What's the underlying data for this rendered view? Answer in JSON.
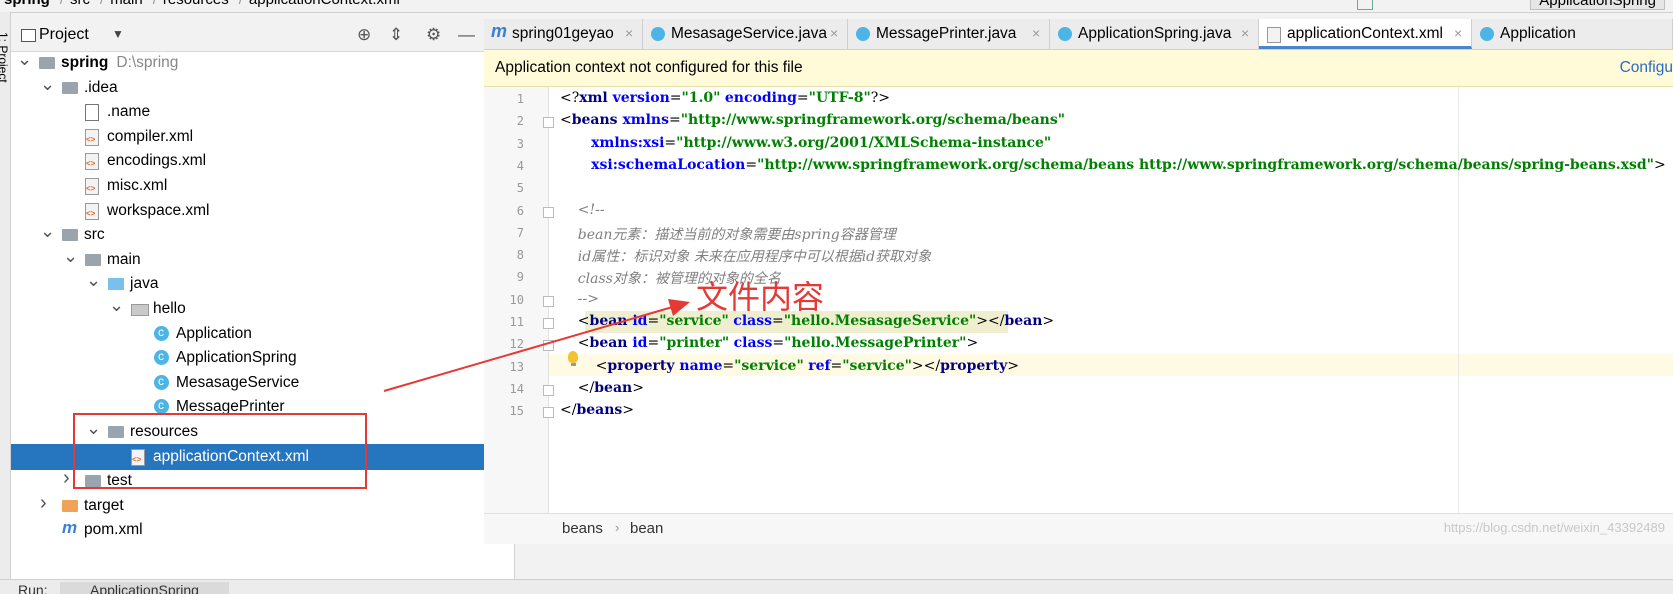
{
  "breadcrumb": [
    "spring",
    "src",
    "main",
    "resources",
    "applicationContext.xml"
  ],
  "run_config": "ApplicationSpring",
  "side_stripe_label": "1: Project",
  "project_panel": {
    "title": "Project",
    "tree": [
      {
        "label": "spring",
        "sub": "D:\\spring",
        "depth": 0,
        "expanded": true,
        "icon": "folder-icon",
        "bold": true
      },
      {
        "label": ".idea",
        "depth": 1,
        "expanded": true,
        "icon": "folder-icon"
      },
      {
        "label": ".name",
        "depth": 2,
        "icon": "file-icon"
      },
      {
        "label": "compiler.xml",
        "depth": 2,
        "icon": "xml-icon"
      },
      {
        "label": "encodings.xml",
        "depth": 2,
        "icon": "xml-icon"
      },
      {
        "label": "misc.xml",
        "depth": 2,
        "icon": "xml-icon"
      },
      {
        "label": "workspace.xml",
        "depth": 2,
        "icon": "xml-icon"
      },
      {
        "label": "src",
        "depth": 1,
        "expanded": true,
        "icon": "folder-icon"
      },
      {
        "label": "main",
        "depth": 2,
        "expanded": true,
        "icon": "folder-icon"
      },
      {
        "label": "java",
        "depth": 3,
        "expanded": true,
        "icon": "source-folder-icon"
      },
      {
        "label": "hello",
        "depth": 4,
        "expanded": true,
        "icon": "package-icon"
      },
      {
        "label": "Application",
        "depth": 5,
        "icon": "class-icon"
      },
      {
        "label": "ApplicationSpring",
        "depth": 5,
        "icon": "class-icon"
      },
      {
        "label": "MesasageService",
        "depth": 5,
        "icon": "class-icon"
      },
      {
        "label": "MessagePrinter",
        "depth": 5,
        "icon": "class-icon"
      },
      {
        "label": "resources",
        "depth": 3,
        "expanded": true,
        "icon": "resources-folder-icon"
      },
      {
        "label": "applicationContext.xml",
        "depth": 4,
        "icon": "xml-icon",
        "selected": true
      },
      {
        "label": "test",
        "depth": 2,
        "expanded": false,
        "icon": "folder-icon"
      },
      {
        "label": "target",
        "depth": 1,
        "expanded": false,
        "icon": "excluded-folder-icon"
      },
      {
        "label": "pom.xml",
        "depth": 1,
        "icon": "maven-icon"
      }
    ]
  },
  "tabs": [
    {
      "label": "spring01geyao",
      "icon": "maven-icon"
    },
    {
      "label": "MesasageService.java",
      "icon": "class-icon"
    },
    {
      "label": "MessagePrinter.java",
      "icon": "class-icon"
    },
    {
      "label": "ApplicationSpring.java",
      "icon": "class-icon"
    },
    {
      "label": "applicationContext.xml",
      "icon": "xml-icon",
      "active": true
    },
    {
      "label": "Application",
      "icon": "class-icon"
    }
  ],
  "banner": {
    "message": "Application context not configured for this file",
    "action": "Configu"
  },
  "code_lines": [
    [
      [
        "plain",
        "<?"
      ],
      [
        "tag",
        "xml "
      ],
      [
        "attr",
        "version"
      ],
      [
        "plain",
        "="
      ],
      [
        "val",
        "\"1.0\""
      ],
      [
        "plain",
        " "
      ],
      [
        "attr",
        "encoding"
      ],
      [
        "plain",
        "="
      ],
      [
        "val",
        "\"UTF-8\""
      ],
      [
        "plain",
        "?>"
      ]
    ],
    [
      [
        "plain",
        "<"
      ],
      [
        "tag",
        "beans "
      ],
      [
        "attr",
        "xmlns"
      ],
      [
        "plain",
        "="
      ],
      [
        "val",
        "\"http://www.springframework.org/schema/beans\""
      ]
    ],
    [
      [
        "plain",
        "       "
      ],
      [
        "attr",
        "xmlns:xsi"
      ],
      [
        "plain",
        "="
      ],
      [
        "val",
        "\"http://www.w3.org/2001/XMLSchema-instance\""
      ]
    ],
    [
      [
        "plain",
        "       "
      ],
      [
        "attr",
        "xsi:schemaLocation"
      ],
      [
        "plain",
        "="
      ],
      [
        "val",
        "\"http://www.springframework.org/schema/beans http://www.springframework.org/schema/beans/spring-beans.xsd\""
      ],
      [
        "plain",
        ">"
      ]
    ],
    [],
    [
      [
        "cmt",
        "    <!--"
      ]
    ],
    [
      [
        "cmt",
        "    bean元素：描述当前的对象需要由spring容器管理"
      ]
    ],
    [
      [
        "cmt",
        "    id属性：标识对象 未来在应用程序中可以根据id获取对象"
      ]
    ],
    [
      [
        "cmt",
        "    class对象：被管理的对象的全名"
      ]
    ],
    [
      [
        "cmt",
        "    -->"
      ]
    ],
    [
      [
        "plain",
        "    <"
      ],
      [
        "tag",
        "bean "
      ],
      [
        "attr",
        "id"
      ],
      [
        "plain",
        "="
      ],
      [
        "val",
        "\"service\""
      ],
      [
        "plain",
        " "
      ],
      [
        "attr",
        "class"
      ],
      [
        "plain",
        "="
      ],
      [
        "val",
        "\"hello.MesasageService\""
      ],
      [
        "plain",
        "></"
      ],
      [
        "tag",
        "bean"
      ],
      [
        "plain",
        ">"
      ]
    ],
    [
      [
        "plain",
        "    <"
      ],
      [
        "tag",
        "bean "
      ],
      [
        "attr",
        "id"
      ],
      [
        "plain",
        "="
      ],
      [
        "val",
        "\"printer\""
      ],
      [
        "plain",
        " "
      ],
      [
        "attr",
        "class"
      ],
      [
        "plain",
        "="
      ],
      [
        "val",
        "\"hello.MessagePrinter\""
      ],
      [
        "plain",
        ">"
      ]
    ],
    [
      [
        "plain",
        "        <"
      ],
      [
        "tag",
        "property "
      ],
      [
        "attr",
        "name"
      ],
      [
        "plain",
        "="
      ],
      [
        "val",
        "\"service\""
      ],
      [
        "plain",
        " "
      ],
      [
        "attr",
        "ref"
      ],
      [
        "plain",
        "="
      ],
      [
        "val",
        "\"service\""
      ],
      [
        "plain",
        "></"
      ],
      [
        "tag",
        "property"
      ],
      [
        "plain",
        ">"
      ]
    ],
    [
      [
        "plain",
        "    </"
      ],
      [
        "tag",
        "bean"
      ],
      [
        "plain",
        ">"
      ]
    ],
    [
      [
        "plain",
        "</"
      ],
      [
        "tag",
        "beans"
      ],
      [
        "plain",
        ">"
      ]
    ]
  ],
  "editor_breadcrumb": [
    "beans",
    "bean"
  ],
  "annotation": "文件内容",
  "watermark": "https://blog.csdn.net/weixin_43392489",
  "run_bar": {
    "label": "Run:",
    "tab": "ApplicationSpring"
  },
  "colors": {
    "accent": "#2675bf",
    "annotation": "#e53935",
    "banner": "#fffbd8"
  }
}
